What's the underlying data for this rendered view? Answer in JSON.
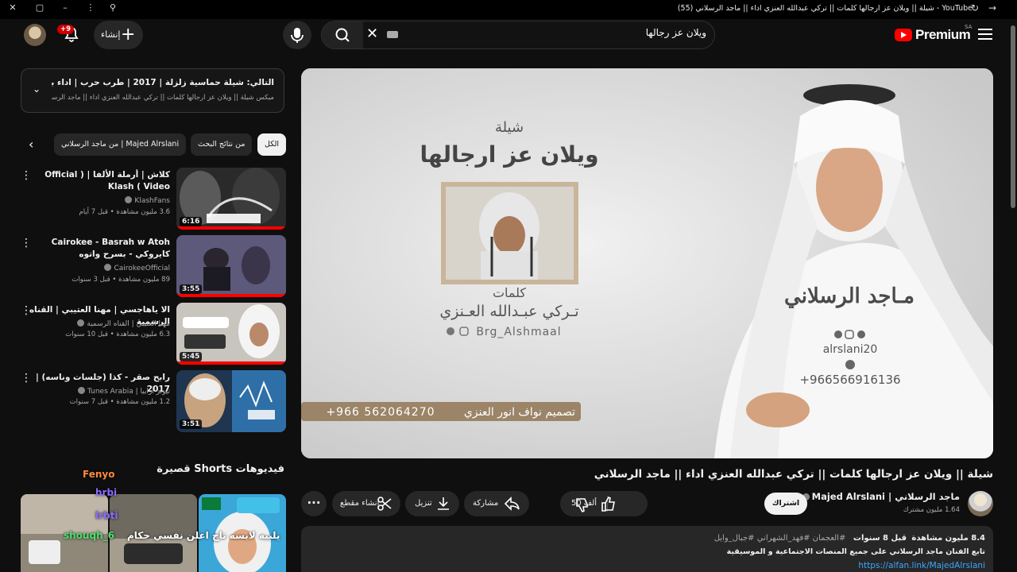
{
  "browser": {
    "tab_title": "YouTube - شيلة || ويلان عز ارجالها كلمات || تركي عبدالله العنزي اداء || ماجد الرسلاني (55)"
  },
  "header": {
    "create_label": "إنشاء",
    "notification_badge": "+9",
    "search_value": "ويلان عز رجالها",
    "logo_text": "Premium",
    "country_code": "SA"
  },
  "queue": {
    "next_title": "التالي: شيلة حماسية زلزلة | 2017 | طرب حرب | اداء بدر الشعيفاني | ...",
    "mix_label": "ميكس شيلة || ويلان عز ارجالها كلمات || تركي عبدالله العنزي اداء || ماجد الرسلاني"
  },
  "chips": {
    "all": "الكل",
    "from_results": "من نتائج البحث",
    "from_channel": "من ماجد الرسلاني | Majed Alrslani"
  },
  "recommendations": [
    {
      "title": "كلاش | أرملة الألفا | ( Official Video ) Klash",
      "channel": "KlashFans",
      "meta": "3.6 مليون مشاهدة • قبل 7 أيام",
      "duration": "6:16"
    },
    {
      "title": "Cairokee - Basrah w Atoh كايروكي - بسرح واتوه",
      "channel": "CairokeeOfficial",
      "meta": "89 مليون مشاهدة • قبل 3 سنوات",
      "duration": "3:55"
    },
    {
      "title": "الا ياهاجسي | مهنا العتيبي | القناه الرسمية",
      "channel": "مهنا العتيبي | القناه الرسمية",
      "meta": "6.3 مليون مشاهدة • قبل 10 سنوات",
      "duration": "5:45"
    },
    {
      "title": "رابح صقر - كذا (جلسات وناسه) | 2017",
      "channel": "تيونز أرابيا | Tunes Arabia",
      "meta": "1.2 مليون مشاهدة • قبل 7 سنوات",
      "duration": "3:51"
    }
  ],
  "shorts": {
    "heading": "فيديوهات Shorts قصيرة",
    "chat_overlay": [
      "hrbi",
      "lrbti",
      "Fenyo",
      "shouqh_6",
      "يلبيه لابسه تاج اعلن نفسي حكام"
    ]
  },
  "video": {
    "title": "شيلة || ويلان عز ارجالها كلمات || تركي عبدالله العنزي اداء || ماجد الرسلاني",
    "art": {
      "genre": "شيلة",
      "song": "ويلان عز ارجالها",
      "lyrics_label": "كلمات",
      "lyricist": "تـركي عبـدالله العـنزي",
      "lyricist_handle": "Brg_Alshmaal",
      "design_credit": "تصميم نواف انور العنزي",
      "design_phone": "+966 562064270",
      "singer": "مـاجد الرسلاني",
      "singer_handle": "alrslani20",
      "singer_phone": "+966566916136"
    }
  },
  "owner": {
    "channel_name": "ماجد الرسلاني | Majed Alrslani",
    "subscribers": "1.64 مليون مشترك",
    "subscribe_label": "اشتراك"
  },
  "actions": {
    "likes": "50 ألف",
    "share": "مشاركة",
    "download": "تنزيل",
    "clip": "إنشاء مقطع",
    "more": "···"
  },
  "description": {
    "views": "8.4 مليون مشاهدة",
    "age": "قبل 8 سنوات",
    "tags": "#العجمان #فهد_الشهراني #جبال_وايل",
    "line2": "تابع الفنان ماجد الرسلاني على جميع المنصات الاجتماعية و الموسيقية",
    "link": "https://alfan.link/MajedAlrslani"
  },
  "colors": {
    "background": "#0f0f0f",
    "surface": "#272727",
    "accent_red": "#ff0000",
    "link_blue": "#3ea6ff"
  }
}
